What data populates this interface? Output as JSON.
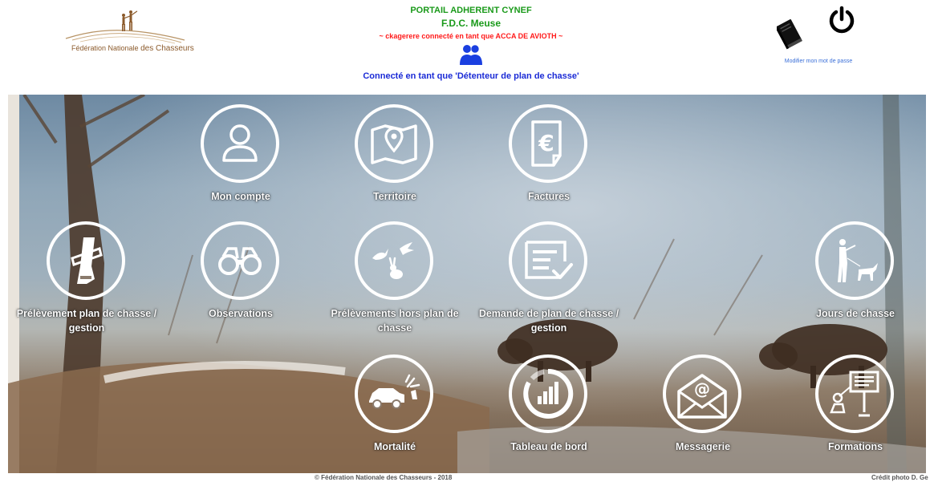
{
  "header": {
    "logo_alt_line1": "Fédération Nationale",
    "logo_alt_line2": "des Chasseurs",
    "portal_title": "PORTAIL ADHERENT CYNEF",
    "federation": "F.D.C. Meuse",
    "connected_as": "~ ckagerere connecté en tant que ACCA DE AVIOTH ~",
    "role_line": "Connecté en tant que 'Détenteur de plan de chasse'",
    "change_password": "Modifier mon mot de passe"
  },
  "icons": {
    "users": "users-icon",
    "book": "book-icon",
    "power": "power-icon"
  },
  "colors": {
    "portal_green": "#1a9a1a",
    "alert_red": "#ff1a1a",
    "role_blue": "#1b2bd6",
    "link_blue": "#3a6fd8"
  },
  "tiles": [
    {
      "label": "Mon compte",
      "icon": "user-icon"
    },
    {
      "label": "Territoire",
      "icon": "map-pin-icon"
    },
    {
      "label": "Factures",
      "icon": "euro-invoice-icon"
    },
    {
      "label": "Prélèvement plan de chasse / gestion",
      "icon": "deer-leg-tag-icon"
    },
    {
      "label": "Observations",
      "icon": "binoculars-icon"
    },
    {
      "label": "Prélèvements hors plan de chasse",
      "icon": "birds-rabbit-icon"
    },
    {
      "label": "Demande de plan de chasse / gestion",
      "icon": "form-check-icon"
    },
    {
      "label": "Jours de chasse",
      "icon": "hunter-dog-icon"
    },
    {
      "label": "Mortalité",
      "icon": "car-deer-collision-icon"
    },
    {
      "label": "Tableau de bord",
      "icon": "dashboard-chart-icon"
    },
    {
      "label": "Messagerie",
      "icon": "mail-at-icon"
    },
    {
      "label": "Formations",
      "icon": "training-board-icon"
    }
  ],
  "footer": {
    "copyright": "© Fédération Nationale des Chasseurs - 2018",
    "photo_credit": "Crédit photo D. Ge"
  }
}
